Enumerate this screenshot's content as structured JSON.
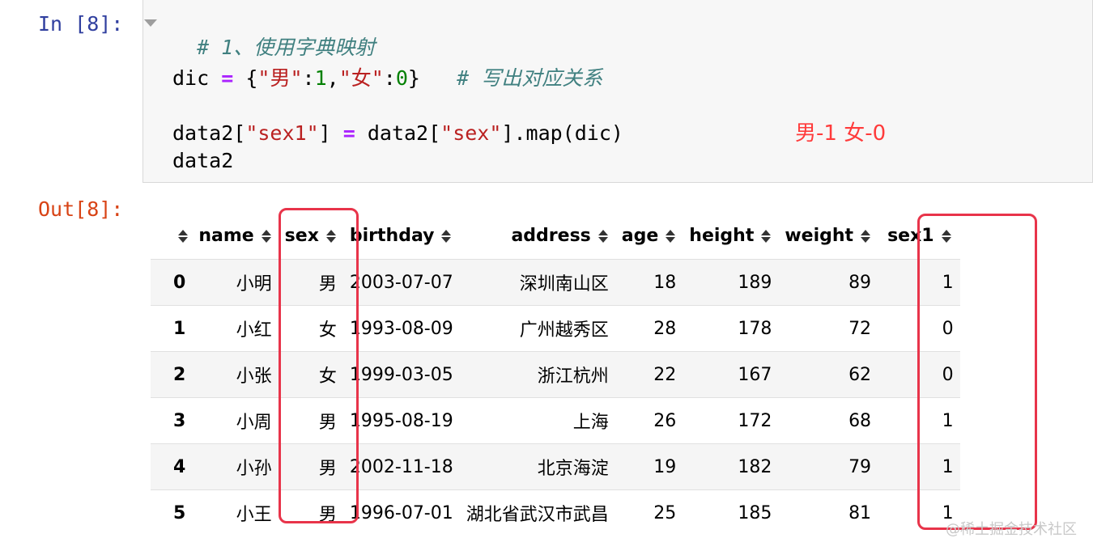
{
  "prompts": {
    "in": "In [8]:",
    "out": "Out[8]:"
  },
  "code": {
    "line1_comment": "# 1、使用字典映射",
    "line2_var": "dic ",
    "line2_op": "=",
    "line2_open": " {",
    "line2_key1": "\"男\"",
    "line2_colon1": ":",
    "line2_val1": "1",
    "line2_comma": ",",
    "line2_key2": "\"女\"",
    "line2_colon2": ":",
    "line2_val2": "0",
    "line2_close": "}   ",
    "line2_comment": "# 写出对应关系",
    "line3_a": "data2[",
    "line3_s1": "\"sex1\"",
    "line3_b": "] ",
    "line3_op": "=",
    "line3_c": " data2[",
    "line3_s2": "\"sex\"",
    "line3_d": "].map(dic)",
    "line4": "data2"
  },
  "annotation": "男-1 女-0",
  "table": {
    "columns": [
      "name",
      "sex",
      "birthday",
      "address",
      "age",
      "height",
      "weight",
      "sex1"
    ],
    "rows": [
      [
        "0",
        "小明",
        "男",
        "2003-07-07",
        "深圳南山区",
        "18",
        "189",
        "89",
        "1"
      ],
      [
        "1",
        "小红",
        "女",
        "1993-08-09",
        "广州越秀区",
        "28",
        "178",
        "72",
        "0"
      ],
      [
        "2",
        "小张",
        "女",
        "1999-03-05",
        "浙江杭州",
        "22",
        "167",
        "62",
        "0"
      ],
      [
        "3",
        "小周",
        "男",
        "1995-08-19",
        "上海",
        "26",
        "172",
        "68",
        "1"
      ],
      [
        "4",
        "小孙",
        "男",
        "2002-11-18",
        "北京海淀",
        "19",
        "182",
        "79",
        "1"
      ],
      [
        "5",
        "小王",
        "男",
        "1996-07-01",
        "湖北省武汉市武昌",
        "25",
        "185",
        "81",
        "1"
      ]
    ]
  },
  "watermark": "@稀土掘金技术社区",
  "colors": {
    "highlight": "#e8344a",
    "annotation": "#ff3b3b",
    "in_prompt": "#303f9f",
    "out_prompt": "#d84315"
  }
}
